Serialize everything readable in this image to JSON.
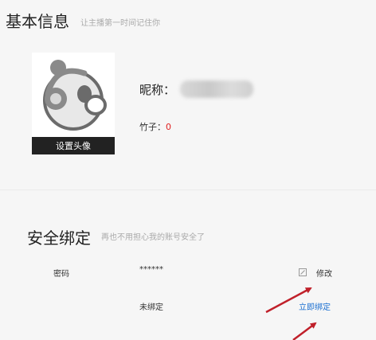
{
  "basic_info": {
    "title": "基本信息",
    "subtitle": "让主播第一时间记住你",
    "avatar_button": "设置头像",
    "nickname_label": "昵称：",
    "bamboo_label": "竹子：",
    "bamboo_value": "0"
  },
  "security": {
    "title": "安全绑定",
    "subtitle": "再也不用担心我的账号安全了",
    "rows": [
      {
        "label": "密码",
        "value": "******",
        "action": "修改",
        "action_icon": "edit-icon"
      },
      {
        "label": "",
        "value": "未绑定",
        "action": "立即绑定"
      }
    ]
  },
  "colors": {
    "background": "#f6f6f6",
    "link": "#1a6fd1",
    "bamboo_count": "#e02020",
    "annotation_arrow": "#c0202a"
  }
}
